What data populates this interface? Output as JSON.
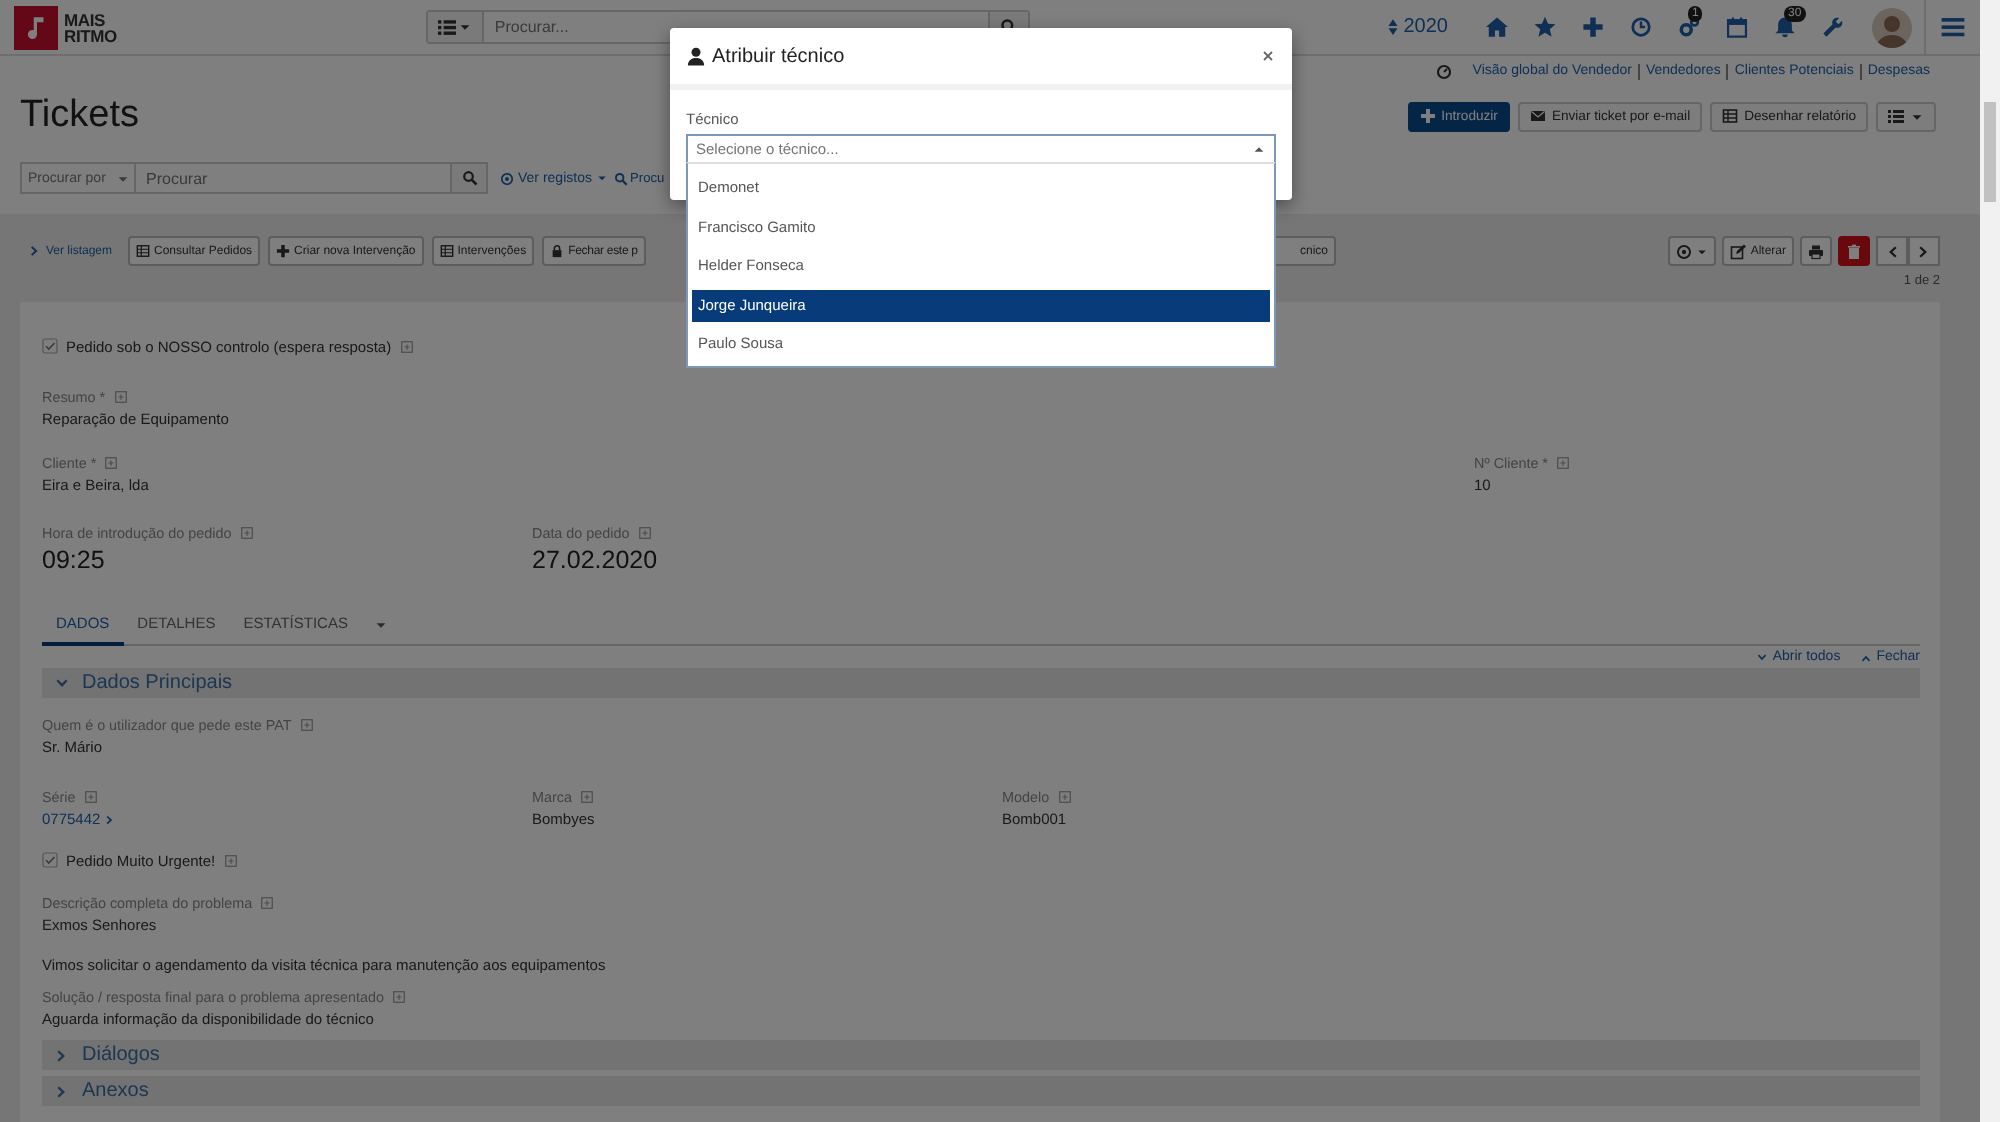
{
  "header": {
    "logo_lines": [
      "MAIS",
      "RITMO"
    ],
    "search_placeholder": "Procurar...",
    "year": "2020",
    "icons": [
      {
        "kind": "home"
      },
      {
        "kind": "star"
      },
      {
        "kind": "plus"
      },
      {
        "kind": "clock"
      },
      {
        "kind": "gears",
        "badge": "1"
      },
      {
        "kind": "calendar"
      },
      {
        "kind": "bell",
        "badge": "30"
      },
      {
        "kind": "wrench"
      }
    ]
  },
  "quick_links": [
    "Visão global do Vendedor",
    "Vendedores",
    "Clientes Potenciais",
    "Despesas"
  ],
  "page_title": "Tickets",
  "actions": [
    {
      "kind": "plus",
      "label": "Introduzir",
      "primary": true
    },
    {
      "kind": "envelope",
      "label": "Enviar ticket por e-mail",
      "primary": false
    },
    {
      "kind": "table",
      "label": "Desenhar relatório",
      "primary": false
    }
  ],
  "search": {
    "scope_placeholder": "Procurar por",
    "placeholder": "Procurar",
    "view_link": "Ver registos",
    "search_link": "Procu"
  },
  "toolbar": {
    "back_link": "Ver listagem",
    "buttons": [
      {
        "kind": "table",
        "label": "Consultar Pedidos"
      },
      {
        "kind": "plus",
        "label": "Criar nova Intervenção"
      },
      {
        "kind": "table",
        "label": "Intervenções"
      },
      {
        "kind": "lock",
        "label": "Fechar este p"
      }
    ],
    "partial_button": "cnico",
    "edit_button": "Alterar",
    "pager": "1 de 2"
  },
  "record": {
    "controlled": {
      "label": "Pedido sob o NOSSO controlo (espera resposta)",
      "checked": true
    },
    "summary": {
      "label": "Resumo *",
      "value": "Reparação de Equipamento"
    },
    "client": {
      "label": "Cliente *",
      "value": "Eira e Beira, lda"
    },
    "client_number": {
      "label": "Nº Cliente *",
      "value": "10"
    },
    "entry_time": {
      "label": "Hora de introdução do pedido",
      "value": "09:25"
    },
    "request_date": {
      "label": "Data do pedido",
      "value": "27.02.2020"
    },
    "tabs": [
      {
        "label": "DADOS",
        "selected": true
      },
      {
        "label": "DETALHES",
        "selected": false
      },
      {
        "label": "ESTATÍSTICAS",
        "selected": false
      }
    ],
    "expand_all": "Abrir todos",
    "collapse_all": "Fechar",
    "sections": [
      {
        "title": "Dados Principais",
        "expanded": true,
        "fields": [
          {
            "kind": "field",
            "label": "Quem é o utilizador que pede este PAT",
            "value": "Sr. Mário"
          },
          {
            "kind": "row",
            "fields": [
              {
                "label": "Série",
                "value": "0775442",
                "link": true
              },
              {
                "label": "Marca",
                "value": "Bombyes",
                "link": false
              },
              {
                "label": "Modelo",
                "value": "Bomb001",
                "link": false
              }
            ]
          },
          {
            "kind": "checkbox",
            "label": "Pedido Muito Urgente!",
            "checked": true
          },
          {
            "kind": "field",
            "label": "Descrição completa do problema",
            "value": "Exmos Senhores"
          },
          {
            "kind": "text",
            "value": "Vimos solicitar o agendamento da visita técnica para manutenção aos equipamentos"
          },
          {
            "kind": "field",
            "label": "Solução / resposta final para o problema apresentado",
            "value": "Aguarda informação da disponibilidade do técnico"
          }
        ]
      },
      {
        "title": "Diálogos",
        "expanded": false
      },
      {
        "title": "Anexos",
        "expanded": false
      }
    ]
  },
  "modal": {
    "title": "Atribuir técnico",
    "field_label": "Técnico",
    "placeholder": "Selecione o técnico...",
    "options": [
      {
        "label": "Demonet",
        "selected": false
      },
      {
        "label": "Francisco Gamito",
        "selected": false
      },
      {
        "label": "Helder Fonseca",
        "selected": false
      },
      {
        "label": "Jorge Junqueira",
        "selected": true
      },
      {
        "label": "Paulo Sousa",
        "selected": false
      }
    ]
  }
}
